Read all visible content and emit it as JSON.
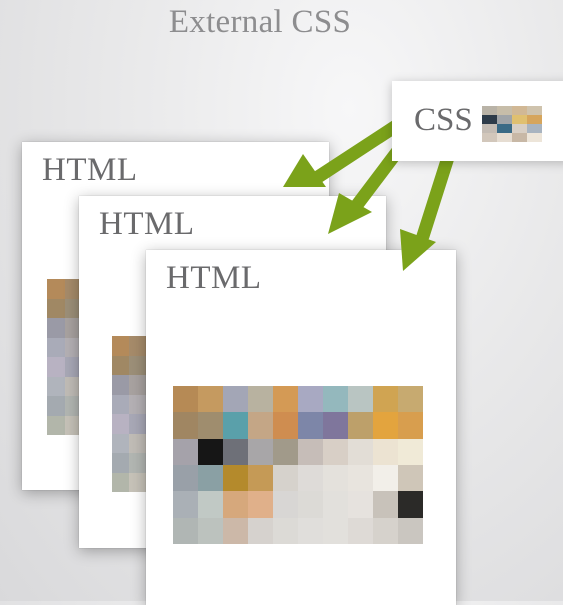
{
  "title": "External CSS",
  "css_box": {
    "label": "CSS"
  },
  "pages": [
    {
      "label": "HTML"
    },
    {
      "label": "HTML"
    },
    {
      "label": "HTML"
    }
  ],
  "colors": {
    "arrow": "#7ba21a",
    "label": "#6a6a6c",
    "title": "#8d8d8f"
  },
  "image_palette": [
    [
      "#b68a55",
      "#c59a60",
      "#a3a6b6",
      "#b8b2a0",
      "#d49a55",
      "#a8a9c2",
      "#94b8bd",
      "#b9c5c2",
      "#d0a452",
      "#c7aa70"
    ],
    [
      "#a08662",
      "#9f8d6e",
      "#5aa0aa",
      "#c4a686",
      "#cf8d50",
      "#7d86a8",
      "#7f769c",
      "#bda06a",
      "#e3a43e",
      "#d89e4e"
    ],
    [
      "#a5a2aa",
      "#161616",
      "#6e7078",
      "#a8a6a8",
      "#a19a8a",
      "#c6bdb8",
      "#d8cfc6",
      "#e2ddd6",
      "#ece3d2",
      "#f0ead7"
    ],
    [
      "#99a0a8",
      "#8aa0a4",
      "#b48a2c",
      "#c59a56",
      "#d6d2cc",
      "#dedbd8",
      "#e4e1dc",
      "#e8e4de",
      "#f2efe9",
      "#cfc6b8"
    ],
    [
      "#aab0b6",
      "#c1c9c5",
      "#d6a87c",
      "#e0b08a",
      "#d8d6d4",
      "#dcdad6",
      "#e2e0dc",
      "#e6e2de",
      "#c8c2ba",
      "#2b2a28"
    ],
    [
      "#b0b6b4",
      "#bcc2be",
      "#ccb8a8",
      "#d6d2ce",
      "#dcdad6",
      "#e0dedb",
      "#e2e0dc",
      "#dedad6",
      "#d6d2cc",
      "#cac6c0"
    ]
  ],
  "side_palette": [
    [
      "#b48a5a",
      "#a68b6a"
    ],
    [
      "#a08864",
      "#9c8f78"
    ],
    [
      "#9a9aa6",
      "#a8a2a0"
    ],
    [
      "#a9abb8",
      "#b4b0b4"
    ],
    [
      "#b8b2c2",
      "#a8a8b6"
    ],
    [
      "#b0b4bc",
      "#c0bcb6"
    ],
    [
      "#a4aab0",
      "#b2b6b2"
    ],
    [
      "#b2b6aa",
      "#c6c2b8"
    ]
  ],
  "thumb_palette": [
    [
      "#b9b3a7",
      "#c7bda9",
      "#d1b895",
      "#cfc3ad"
    ],
    [
      "#2d3b49",
      "#a0a4a8",
      "#e0c070",
      "#d6a55c"
    ],
    [
      "#c4bcb4",
      "#3a6a86",
      "#d8cfc5",
      "#a9b4c0"
    ],
    [
      "#d2c7bb",
      "#e6ddd2",
      "#c8b8a6",
      "#ede5d9"
    ]
  ]
}
